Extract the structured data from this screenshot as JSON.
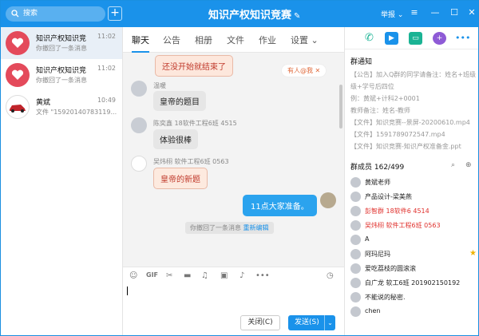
{
  "titlebar": {
    "search_placeholder": "搜索",
    "title": "知识产权知识竞赛",
    "report": "举报",
    "accent": "#1a92ea"
  },
  "conversations": [
    {
      "name": "知识产权知识竞",
      "time": "11:02",
      "msg": "你撤回了一条消息",
      "active": true
    },
    {
      "name": "知识产权知识竞",
      "time": "11:02",
      "msg": "你撤回了一条消息",
      "active": false
    },
    {
      "name": "黄斌",
      "time": "10:49",
      "msg": "文件 \"15920140783119...",
      "active": false
    }
  ],
  "tabs": [
    "聊天",
    "公告",
    "相册",
    "文件",
    "作业",
    "设置"
  ],
  "messages": {
    "m1": "还没开始就结束了",
    "you_have": "有人@我",
    "u2": "温暖",
    "m2": "皇帝的题目",
    "u3": "陈奕鑫 18软件工程6班 4515",
    "m3": "体验很棒",
    "u4": "吴炜栩 软件工程6班 0563",
    "m4": "皇帝的新题",
    "m5": "11点大家准备。",
    "recall": "你撤回了一条消息",
    "reedit": "重新编辑"
  },
  "input": {
    "close_label": "关闭(C)",
    "send_label": "发送(S)"
  },
  "group": {
    "notice_title": "群通知",
    "notice_lines": [
      "【公告】加入Q群的同学请备注：姓名+班级",
      "级+学号后四位",
      "例：黄斌+计科2+0001",
      "教师备注：姓名-教师",
      "【文件】知识竞赛--景屏-20200610.mp4",
      "【文件】1591789072547.mp4",
      "【文件】知识竞赛-知识产权准备金.ppt"
    ],
    "members_title": "群成员 162/499",
    "members": [
      {
        "name": "黄斌老师",
        "red": false
      },
      {
        "name": "产品设计-梁美燕",
        "red": false
      },
      {
        "name": "彭智群 18软件6 4514",
        "red": true
      },
      {
        "name": "吴炜栩 软件工程6班 0563",
        "red": true
      },
      {
        "name": "A",
        "red": false
      },
      {
        "name": "阿玛尼玛",
        "red": false
      },
      {
        "name": "爱吃荔枝的圆滚滚",
        "red": false
      },
      {
        "name": "白广龙 软工6班 201902150192",
        "red": false
      },
      {
        "name": "不能说的秘密.",
        "red": false
      },
      {
        "name": "chen",
        "red": false
      }
    ]
  }
}
